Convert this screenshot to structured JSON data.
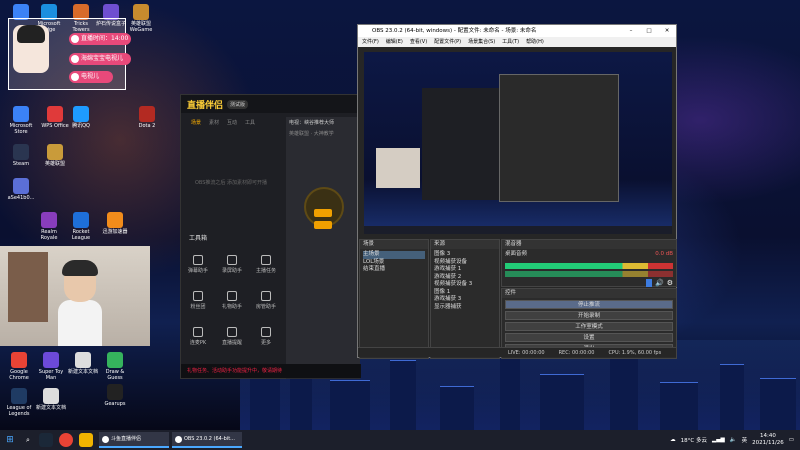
{
  "desktop": {
    "icons_top": [
      "Microsoft Edge",
      "Tricks Towers",
      "炉石传说盒子",
      "英雄联盟 WeGame"
    ],
    "icons_left": [
      {
        "label": "Microsoft Store",
        "color": "#3b82f6"
      },
      {
        "label": "WPS Office",
        "color": "#e03a3a"
      },
      {
        "label": "腾讯QQ",
        "color": "#1e9bff"
      },
      {
        "label": "Dota 2",
        "color": "#b32a22"
      },
      {
        "label": "Steam",
        "color": "#2a3550"
      },
      {
        "label": "英雄联盟",
        "color": "#c99b3a"
      },
      {
        "label": "aSe41b0...",
        "color": "#5b6fd6"
      },
      {
        "label": "Realm Royale",
        "color": "#883dbd"
      },
      {
        "label": "Rocket League",
        "color": "#1e6fd9"
      },
      {
        "label": "迅游加速器",
        "color": "#f28c1b"
      }
    ],
    "icons_bottom": [
      {
        "label": "Google Chrome",
        "color": "#e84335"
      },
      {
        "label": "Super Toy Man",
        "color": "#6c4ad9"
      },
      {
        "label": "新建文本文档",
        "color": "#dddddd"
      },
      {
        "label": "Draw & Guess",
        "color": "#35b35d"
      },
      {
        "label": "Gearups",
        "color": "#222222"
      },
      {
        "label": "League of Legends",
        "color": "#1f3b63"
      },
      {
        "label": "新建文本文档",
        "color": "#dddddd"
      }
    ]
  },
  "overlay": {
    "time_label": "直播时间：14:00",
    "pill2": "海绵宝宝电视儿",
    "pill3": "电视儿"
  },
  "zhibo_app": {
    "logo": "直播伴侣",
    "version": "测试版",
    "tabs": [
      "场景",
      "素材",
      "互动",
      "工具"
    ],
    "empty_text": "OBS推流之后 添加素材即可开播",
    "right_title": "电视：峡谷推荐大师",
    "right_sub": "英雄联盟 · 大神教学",
    "tools_title": "工具箱",
    "tools": [
      "弹幕助手",
      "录屏助手",
      "主播任务",
      "粉丝团",
      "礼物助手",
      "房管助手",
      "连麦PK",
      "直播提醒",
      "更多"
    ],
    "start_btn": "开始直播",
    "stop_btn": "关闭",
    "status_text": "礼物任务、活动助手功能提升中，敬请期待"
  },
  "obs": {
    "title": "OBS 23.0.2 (64-bit, windows) - 配置文件: 未命名 - 场景: 未命名",
    "menu": [
      "文件(F)",
      "编辑(E)",
      "查看(V)",
      "配置文件(P)",
      "场景集合(S)",
      "工具(T)",
      "帮助(H)"
    ],
    "scenes_header": "场景",
    "scenes": [
      "主场景",
      "LOL场景",
      "结束直播"
    ],
    "sources_header": "来源",
    "sources": [
      "图像 3",
      "视频捕获设备",
      "游戏捕获 1",
      "游戏捕获 2",
      "视频捕获设备 3",
      "图像 1",
      "游戏捕获 3",
      "显示器捕获"
    ],
    "mixer_header": "混音器",
    "mixer_label": "桌面音频",
    "mixer_db": "0.0 dB",
    "controls_header": "控件",
    "controls": [
      "停止推流",
      "开始录制",
      "工作室模式",
      "设置",
      "退出"
    ],
    "status": {
      "live": "LIVE: 00:00:00",
      "rec": "REC: 00:00:00",
      "cpu": "CPU: 1.9%, 60.00 fps"
    }
  },
  "taskbar": {
    "tasks": [
      "斗鱼直播伴侣",
      "OBS 23.0.2 (64-bit..."
    ],
    "weather": "18°C 多云",
    "time": "14:40",
    "date": "2021/11/26",
    "ime": "英"
  }
}
